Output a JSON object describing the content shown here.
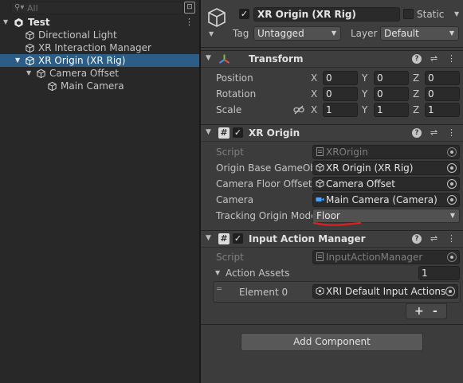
{
  "hierarchy": {
    "search_placeholder": "All",
    "scene": {
      "name": "Test"
    },
    "items": [
      {
        "label": "Directional Light"
      },
      {
        "label": "XR Interaction Manager"
      },
      {
        "label": "XR Origin (XR Rig)"
      },
      {
        "label": "Camera Offset"
      },
      {
        "label": "Main Camera"
      }
    ]
  },
  "inspector": {
    "name": "XR Origin (XR Rig)",
    "static_label": "Static",
    "tag_label": "Tag",
    "tag_value": "Untagged",
    "layer_label": "Layer",
    "layer_value": "Default",
    "transform": {
      "title": "Transform",
      "position": {
        "label": "Position",
        "x": "0",
        "y": "0",
        "z": "0"
      },
      "rotation": {
        "label": "Rotation",
        "x": "0",
        "y": "0",
        "z": "0"
      },
      "scale": {
        "label": "Scale",
        "x": "1",
        "y": "1",
        "z": "1"
      },
      "axis": {
        "x": "X",
        "y": "Y",
        "z": "Z"
      }
    },
    "xr_origin": {
      "title": "XR Origin",
      "script_label": "Script",
      "script_value": "XROrigin",
      "origin_base_label": "Origin Base GameObj",
      "origin_base_value": "XR Origin (XR Rig)",
      "floor_offset_label": "Camera Floor Offset (",
      "floor_offset_value": "Camera Offset",
      "camera_label": "Camera",
      "camera_value": "Main Camera (Camera)",
      "tracking_label": "Tracking Origin Mode",
      "tracking_value": "Floor"
    },
    "input_action_manager": {
      "title": "Input Action Manager",
      "script_label": "Script",
      "script_value": "InputActionManager",
      "action_assets_label": "Action Assets",
      "action_assets_count": "1",
      "element_label": "Element 0",
      "element_value": "XRI Default Input Actions",
      "plus": "+",
      "minus": "-"
    },
    "add_component": "Add Component"
  },
  "colors": {
    "selection": "#2c5d87",
    "annotation_underline": "#e02020",
    "transform_icon_red": "#d9534f",
    "transform_icon_green": "#7bc043",
    "transform_icon_blue": "#4a90e2",
    "camera_icon": "#4da3ff"
  }
}
